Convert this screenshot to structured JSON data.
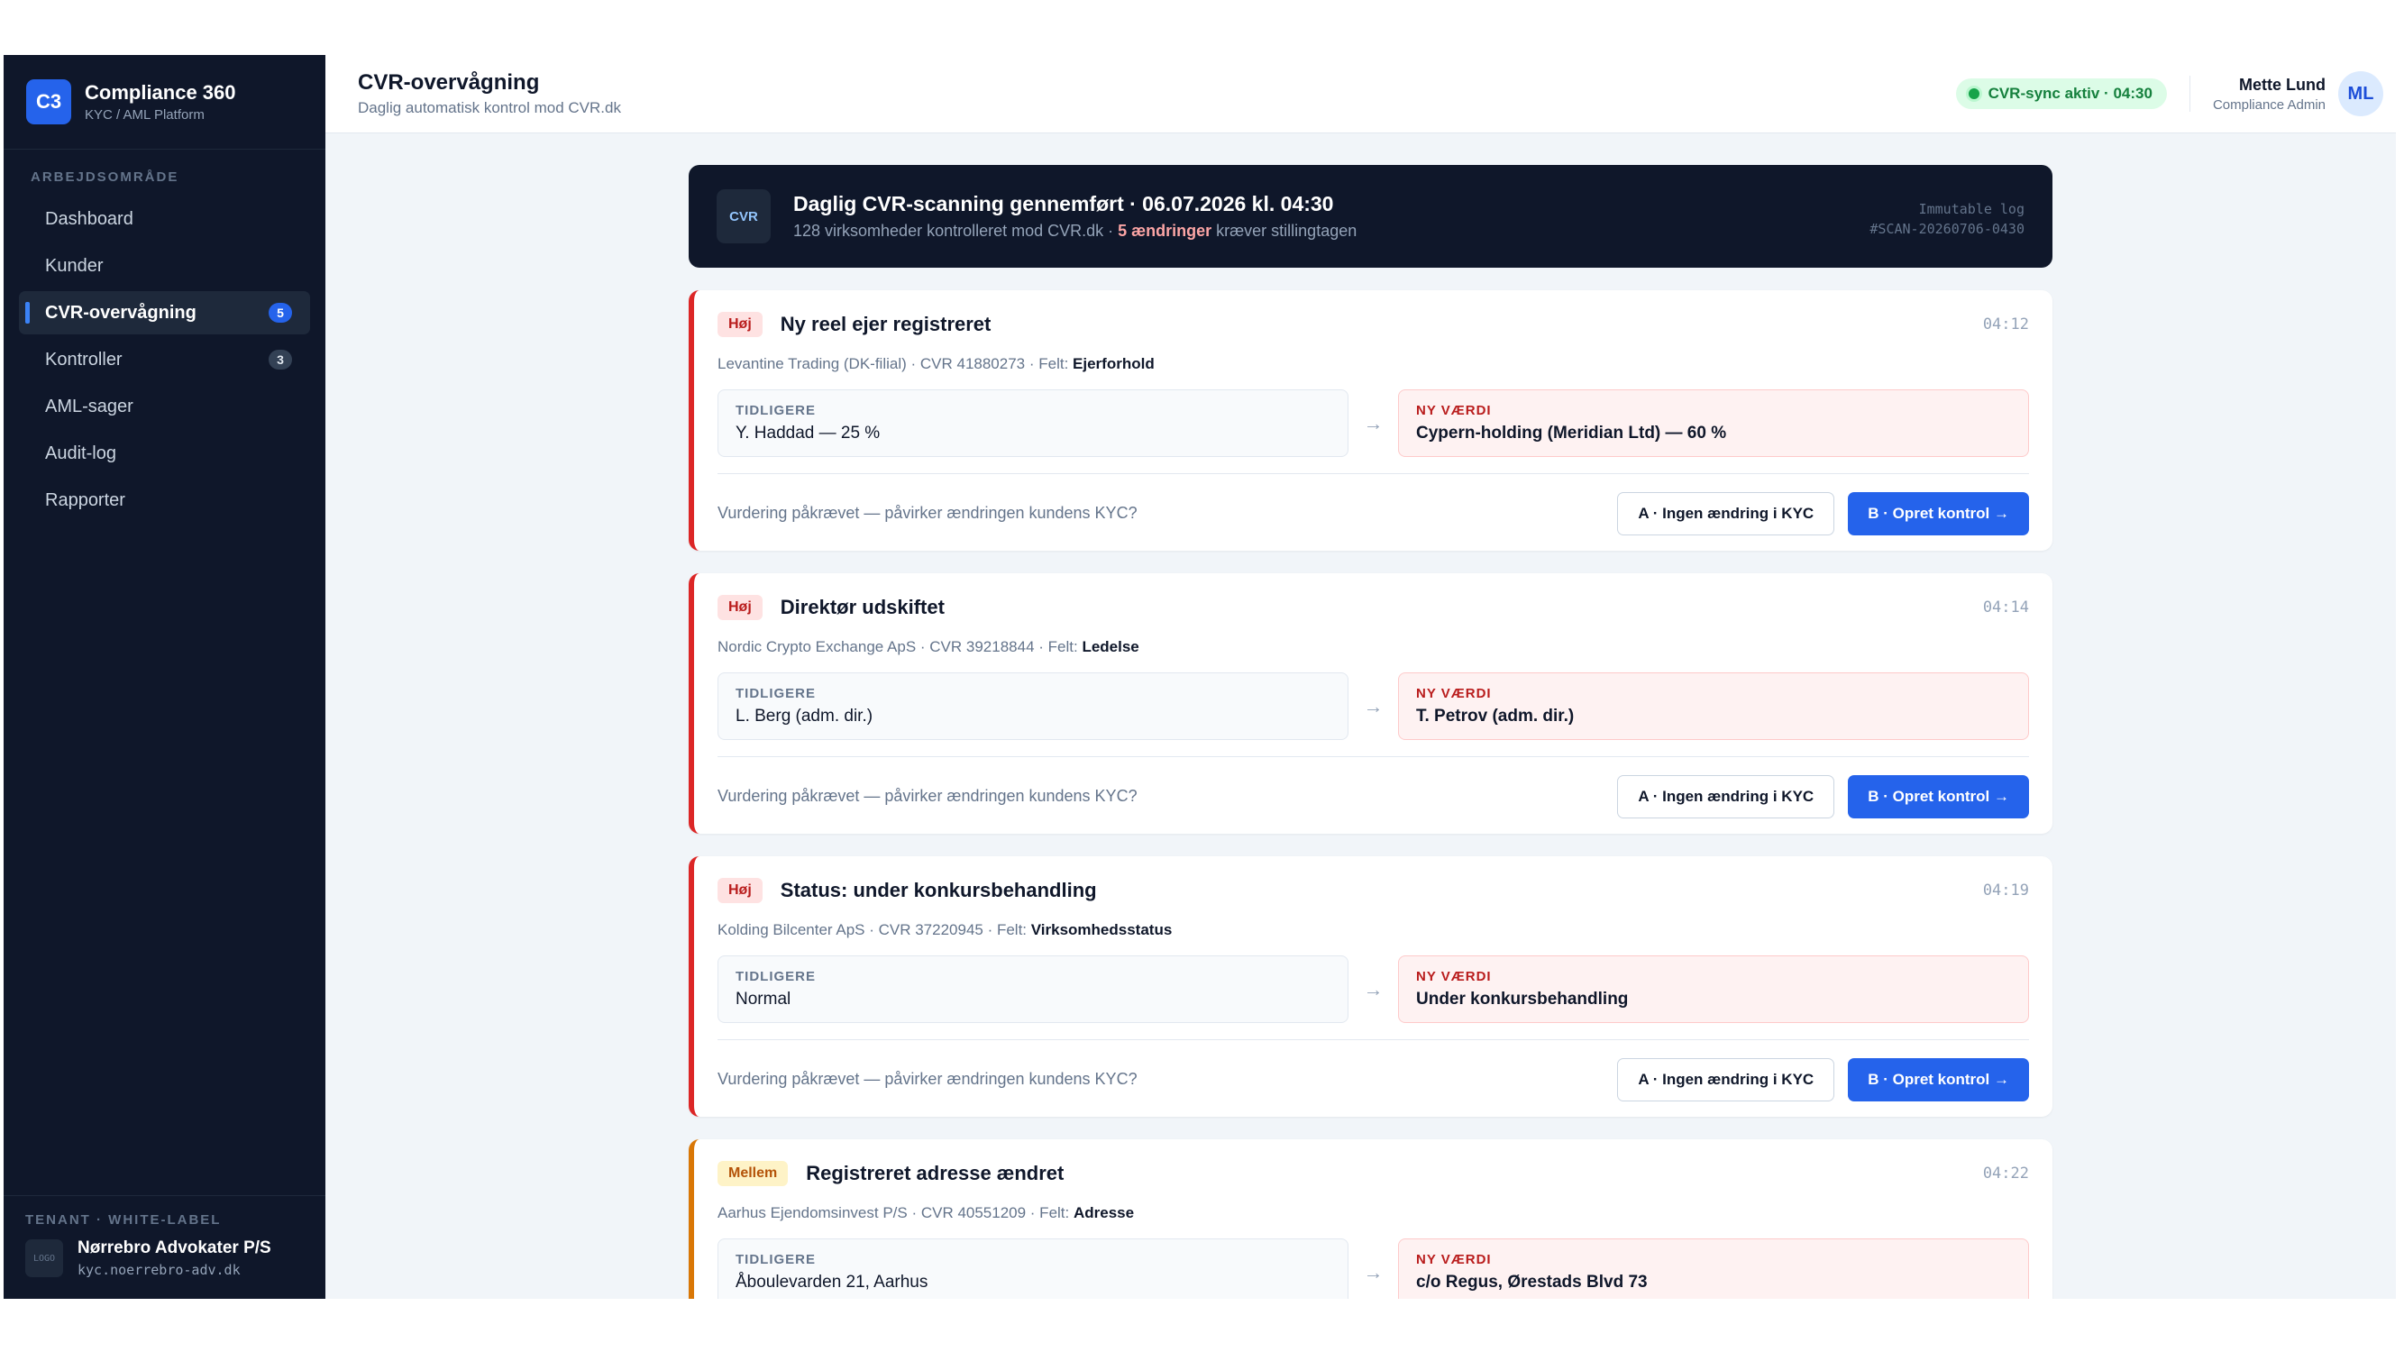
{
  "brand": {
    "logo": "C3",
    "name": "Compliance 360",
    "sub": "KYC / AML Platform"
  },
  "sidebar": {
    "section_label": "ARBEJDSOMRÅDE",
    "items": [
      {
        "label": "Dashboard",
        "count": ""
      },
      {
        "label": "Kunder",
        "count": ""
      },
      {
        "label": "CVR-overvågning",
        "count": "5",
        "active": true
      },
      {
        "label": "Kontroller",
        "count": "3"
      },
      {
        "label": "AML-sager",
        "count": ""
      },
      {
        "label": "Audit-log",
        "count": ""
      },
      {
        "label": "Rapporter",
        "count": ""
      }
    ],
    "tenant": {
      "label": "TENANT · WHITE-LABEL",
      "logo": "LOGO",
      "name": "Nørrebro Advokater P/S",
      "url": "kyc.noerrebro-adv.dk"
    }
  },
  "header": {
    "title": "CVR-overvågning",
    "subtitle": "Daglig automatisk kontrol mod CVR.dk",
    "sync_status": "CVR-sync aktiv · 04:30",
    "user_name": "Mette Lund",
    "user_role": "Compliance Admin",
    "user_initials": "ML"
  },
  "banner": {
    "icon": "CVR",
    "title": "Daglig CVR-scanning gennemført · 06.07.2026 kl. 04:30",
    "sub_prefix": "128 virksomheder kontrolleret mod CVR.dk · ",
    "sub_highlight": "5 ændringer",
    "sub_suffix": " kræver stillingtagen",
    "log_label": "Immutable log",
    "log_id": "#SCAN-20260706-0430"
  },
  "labels": {
    "old": "TIDLIGERE",
    "new": "NY VÆRDI",
    "arrow": "→",
    "question": "Vurdering påkrævet — påvirker ændringen kundens KYC?",
    "btn_a": "A · Ingen ændring i KYC",
    "btn_b": "B · Opret kontrol →",
    "field_prefix": " · Felt: "
  },
  "changes": [
    {
      "severity": "Høj",
      "title": "Ny reel ejer registreret",
      "time": "04:12",
      "company": "Levantine Trading (DK-filial) · CVR 41880273",
      "field": "Ejerforhold",
      "old": "Y. Haddad — 25 %",
      "new": "Cypern-holding (Meridian Ltd) — 60 %"
    },
    {
      "severity": "Høj",
      "title": "Direktør udskiftet",
      "time": "04:14",
      "company": "Nordic Crypto Exchange ApS · CVR 39218844",
      "field": "Ledelse",
      "old": "L. Berg (adm. dir.)",
      "new": "T. Petrov (adm. dir.)"
    },
    {
      "severity": "Høj",
      "title": "Status: under konkursbehandling",
      "time": "04:19",
      "company": "Kolding Bilcenter ApS · CVR 37220945",
      "field": "Virksomhedsstatus",
      "old": "Normal",
      "new": "Under konkursbehandling"
    },
    {
      "severity": "Mellem",
      "title": "Registreret adresse ændret",
      "time": "04:22",
      "company": "Aarhus Ejendomsinvest P/S · CVR 40551209",
      "field": "Adresse",
      "old": "Åboulevarden 21, Aarhus",
      "new": "c/o Regus, Ørestads Blvd 73"
    }
  ]
}
